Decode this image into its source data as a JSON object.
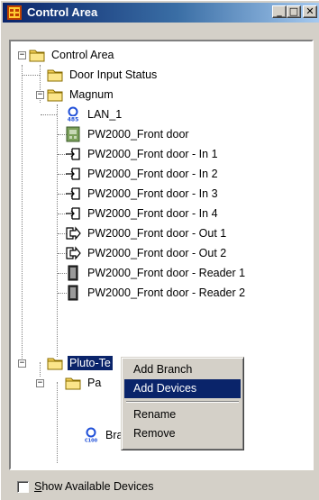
{
  "window": {
    "title": "Control Area",
    "buttons": {
      "minimize": "_",
      "maximize": "□",
      "close": "✕"
    }
  },
  "tree": {
    "nodes": [
      {
        "label": "Control Area",
        "icon": "folder-icon"
      },
      {
        "label": "Door Input Status",
        "icon": "folder-icon"
      },
      {
        "label": "Magnum",
        "icon": "folder-icon"
      },
      {
        "label": "LAN_1",
        "icon": "lan-485-icon",
        "icon_text": "485"
      },
      {
        "label": "PW2000_Front door",
        "icon": "controller-board-icon"
      },
      {
        "label": "PW2000_Front door - In 1",
        "icon": "input-plug-icon"
      },
      {
        "label": "PW2000_Front door - In 2",
        "icon": "input-plug-icon"
      },
      {
        "label": "PW2000_Front door - In 3",
        "icon": "input-plug-icon"
      },
      {
        "label": "PW2000_Front door - In 4",
        "icon": "input-plug-icon"
      },
      {
        "label": "PW2000_Front door - Out 1",
        "icon": "output-arrow-icon"
      },
      {
        "label": "PW2000_Front door - Out 2",
        "icon": "output-arrow-icon"
      },
      {
        "label": "PW2000_Front door - Reader 1",
        "icon": "card-reader-icon"
      },
      {
        "label": "PW2000_Front door - Reader 2",
        "icon": "card-reader-icon"
      },
      {
        "label": "Pluto-Te",
        "icon": "folder-icon",
        "selected": true
      },
      {
        "label": "Pa",
        "icon": "folder-icon"
      },
      {
        "label": "Brands",
        "icon": "c100-device-icon",
        "icon_text": "C100"
      }
    ]
  },
  "context_menu": {
    "items": [
      {
        "label": "Add Branch"
      },
      {
        "label": "Add Devices",
        "highlighted": true
      },
      {
        "label": "Rename"
      },
      {
        "label": "Remove"
      }
    ]
  },
  "show_available_devices": {
    "label_underlined": "S",
    "label_rest": "how Available Devices",
    "checked": false
  }
}
